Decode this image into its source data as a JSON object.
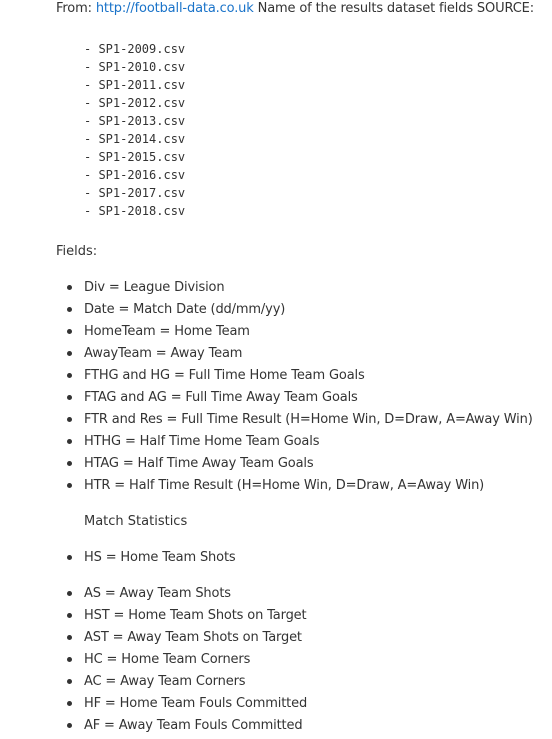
{
  "source": {
    "prefix": "From: ",
    "link_text": "http://football-data.co.uk",
    "suffix": " Name of the results dataset fields SOURCE:"
  },
  "files": [
    "- SP1-2009.csv",
    "- SP1-2010.csv",
    "- SP1-2011.csv",
    "- SP1-2012.csv",
    "- SP1-2013.csv",
    "- SP1-2014.csv",
    "- SP1-2015.csv",
    "- SP1-2016.csv",
    "- SP1-2017.csv",
    "- SP1-2018.csv"
  ],
  "fields_heading": "Fields:",
  "fields": [
    "Div = League Division",
    "Date = Match Date (dd/mm/yy)",
    "HomeTeam = Home Team",
    "AwayTeam = Away Team",
    "FTHG and HG = Full Time Home Team Goals",
    "FTAG and AG = Full Time Away Team Goals",
    "FTR and Res = Full Time Result (H=Home Win, D=Draw, A=Away Win)",
    "HTHG = Half Time Home Team Goals",
    "HTAG = Half Time Away Team Goals",
    "HTR = Half Time Result (H=Home Win, D=Draw, A=Away Win)"
  ],
  "match_statistics_heading": "Match Statistics",
  "stats_first": [
    "HS = Home Team Shots"
  ],
  "stats_rest": [
    "AS = Away Team Shots",
    "HST = Home Team Shots on Target",
    "AST = Away Team Shots on Target",
    "HC = Home Team Corners",
    "AC = Away Team Corners",
    "HF = Home Team Fouls Committed",
    "AF = Away Team Fouls Committed"
  ],
  "colors": {
    "text": "#333333",
    "link": "#1a73c9",
    "background": "#ffffff"
  }
}
